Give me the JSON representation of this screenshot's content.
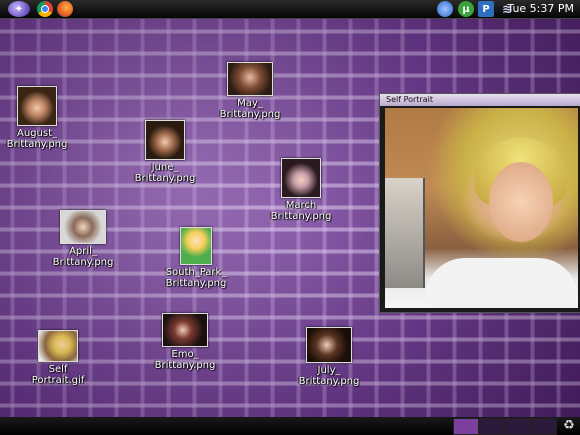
{
  "top_panel": {
    "clock": "Tue 5:37 PM",
    "launchers": [
      "menu-icon",
      "chrome-icon",
      "firefox-icon"
    ],
    "tray": [
      "system-icon",
      "utorrent-icon",
      "p-icon",
      "wifi-icon"
    ]
  },
  "desktop_icons": [
    {
      "name": "may",
      "label": "May_\nBrittany.png"
    },
    {
      "name": "august",
      "label": "August_\nBrittany.png"
    },
    {
      "name": "june",
      "label": "June_\nBrittany.png"
    },
    {
      "name": "march",
      "label": "March\nBrittany.png"
    },
    {
      "name": "april",
      "label": "April_\nBrittany.png"
    },
    {
      "name": "south-park",
      "label": "South_Park_\nBrittany.png"
    },
    {
      "name": "self-portrait",
      "label": "Self\nPortrait.gif"
    },
    {
      "name": "emo",
      "label": "Emo_\nBrittany.png"
    },
    {
      "name": "july",
      "label": "July_\nBrittany.png"
    }
  ],
  "window": {
    "title": "Self Portrait"
  },
  "bottom_panel": {
    "workspaces": 4,
    "active_workspace": 1,
    "trash_icon": "recycle-icon"
  },
  "colors": {
    "accent": "#7b3f9e",
    "wallpaper": "#7a4d9a"
  }
}
